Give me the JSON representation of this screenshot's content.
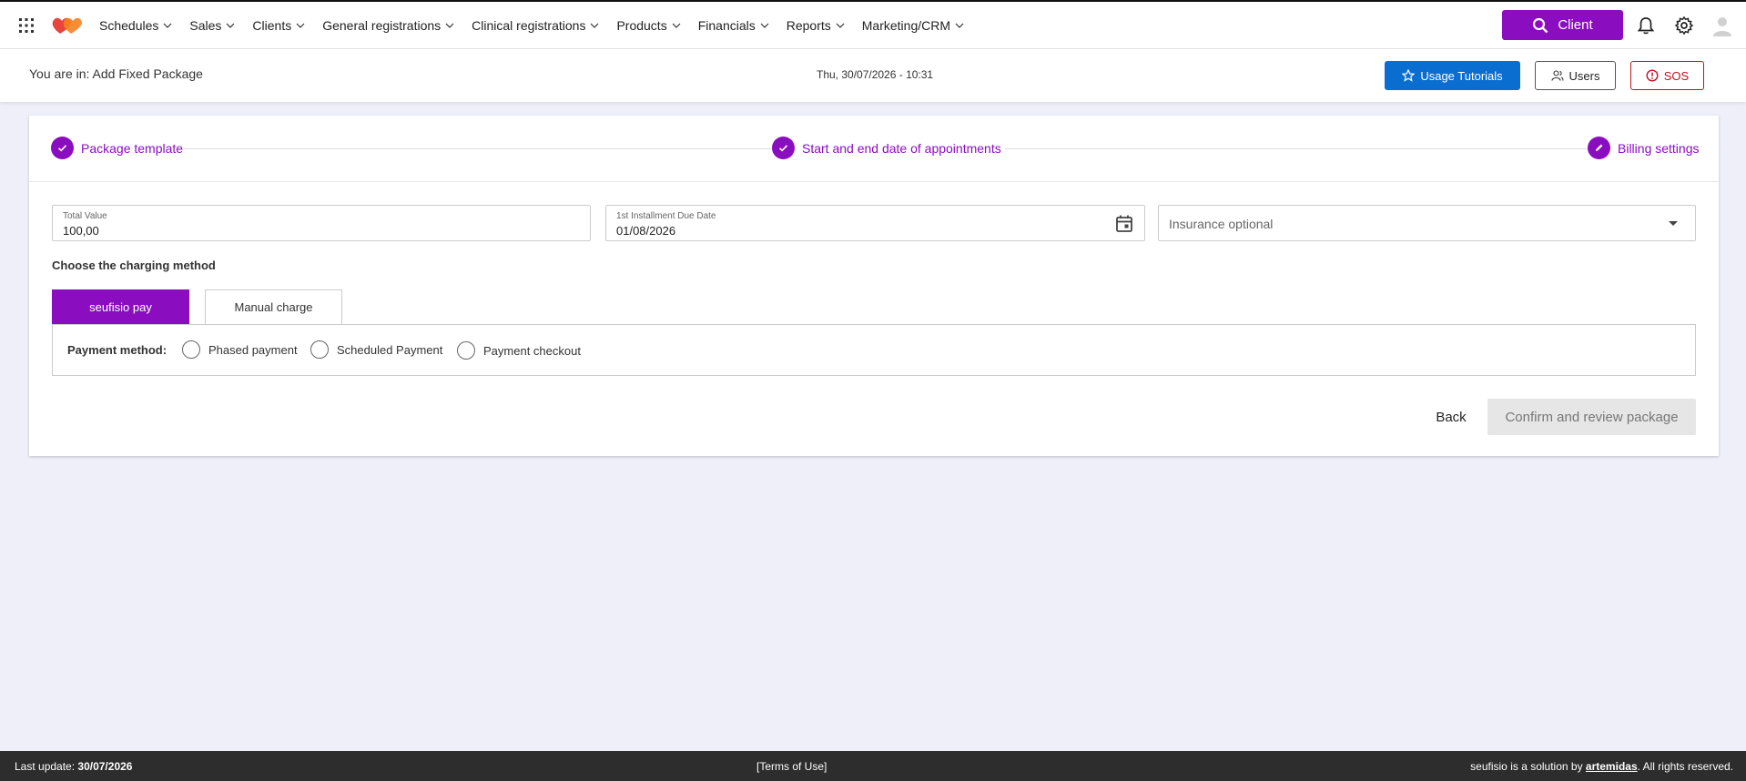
{
  "nav": {
    "items": [
      {
        "label": "Schedules"
      },
      {
        "label": "Sales"
      },
      {
        "label": "Clients"
      },
      {
        "label": "General registrations"
      },
      {
        "label": "Clinical registrations"
      },
      {
        "label": "Products"
      },
      {
        "label": "Financials"
      },
      {
        "label": "Reports"
      },
      {
        "label": "Marketing/CRM"
      }
    ],
    "client_button": "Client",
    "icons": [
      "apps-grid-icon",
      "search-icon",
      "bell-icon",
      "gear-icon",
      "user-avatar-icon"
    ]
  },
  "subheader": {
    "breadcrumb": "You are in: Add Fixed Package",
    "datetime": "Thu, 30/07/2026 - 10:31",
    "tutorials_button": "Usage Tutorials",
    "users_button": "Users",
    "sos_button": "SOS"
  },
  "stepper": {
    "steps": [
      {
        "label": "Package template",
        "state": "done"
      },
      {
        "label": "Start and end date of appointments",
        "state": "done"
      },
      {
        "label": "Billing settings",
        "state": "current"
      }
    ]
  },
  "form": {
    "total_value": {
      "label": "Total Value",
      "value": "100,00"
    },
    "due_date": {
      "label": "1st Installment Due Date",
      "value": "01/08/2026"
    },
    "insurance": {
      "placeholder": "Insurance optional"
    },
    "charging_title": "Choose the charging method",
    "tabs": [
      {
        "label": "seufisio pay",
        "active": true
      },
      {
        "label": "Manual charge",
        "active": false
      }
    ],
    "payment_method_label": "Payment method:",
    "payment_options": [
      {
        "label": "Phased payment"
      },
      {
        "label": "Scheduled Payment"
      },
      {
        "label": "Payment checkout"
      }
    ],
    "back_button": "Back",
    "confirm_button": "Confirm and review package"
  },
  "footer": {
    "last_update_label": "Last update:",
    "last_update_date": "30/07/2026",
    "terms": "[Terms of Use]",
    "credit_prefix": "seufisio is a solution by",
    "credit_link": "artemidas",
    "credit_suffix": ". All rights reserved."
  },
  "colors": {
    "brand_purple": "#8a0dbf",
    "tutorial_blue": "#0a6ed1",
    "sos_red": "#c1121f",
    "page_bg": "#eeeff9",
    "footer_bg": "#2d2d2d"
  }
}
